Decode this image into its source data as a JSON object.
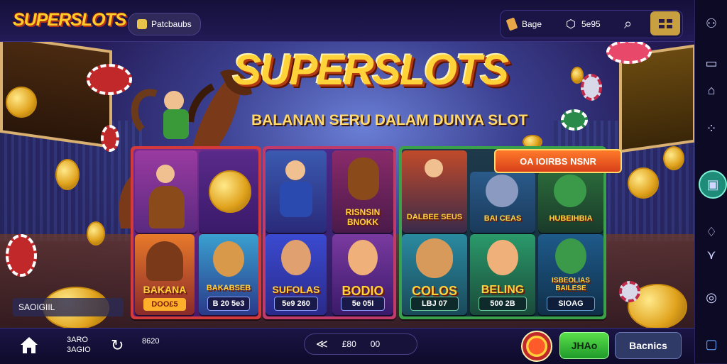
{
  "header": {
    "logo_text": "SUPERSLOTS",
    "badge_label": "Patcbaubs",
    "balance_label": "Bage",
    "shop_label": "5e95"
  },
  "hero": {
    "title": "SUPERSLOTS",
    "subtitle": "BALANAN SERU DALAM DUNYA SLOT"
  },
  "promo": {
    "label": "OA IOIRBS NSNR"
  },
  "cards": [
    {
      "top_label": "",
      "label": "BAKANA",
      "value": "DOO£5",
      "bg": "#7a2a8a",
      "frame": "#d43a3a"
    },
    {
      "top_label": "",
      "label": "BAKABSEB",
      "value": "B 20 5e3",
      "bg": "#4a2a8a",
      "frame": "#d43a3a"
    },
    {
      "top_label": "",
      "label": "SUFOLAS",
      "value": "5e9 260",
      "bg": "#3a3aa0",
      "frame": "#c03a6a"
    },
    {
      "top_label": "RISNSIN BNOKK",
      "label": "BODIO",
      "value": "5e 05I",
      "bg": "#6a2a7a",
      "frame": "#c03a6a"
    },
    {
      "top_label": "DALBEE SEUS",
      "label": "COLOS",
      "value": "LBJ 07",
      "bg": "#2a5a4a",
      "frame": "#3aa04a"
    },
    {
      "top_label": "BAI CEAS",
      "label": "BELING",
      "value": "500 2B",
      "bg": "#1e4a5a",
      "frame": "#3aa04a"
    },
    {
      "top_label": "HUBEIHBIA",
      "label": "ISBEOLIAS BAILESE",
      "value": "SIOAG",
      "bg": "#1e3a6a",
      "frame": "#3aa04a"
    }
  ],
  "info_box": "SAOIGIIL",
  "bottom": {
    "home_label_1": "3ARO",
    "home_label_2": "3AGIO",
    "reload_label": "8620",
    "center_a": "£80",
    "center_b": "00",
    "green_button": "JHAo",
    "dark_button": "Bacnics"
  },
  "icons": [
    "user-icon",
    "shop-icon",
    "search-icon",
    "grid-icon",
    "home-icon",
    "reload-icon",
    "back-icon",
    "menu-icon",
    "house-icon",
    "dots-icon",
    "gamepad-icon",
    "chat-icon",
    "chevron-icon",
    "compass-icon"
  ],
  "colors": {
    "accent_gold": "#ffd23a",
    "green": "#2ec24a",
    "teal": "#1f8c7a"
  }
}
